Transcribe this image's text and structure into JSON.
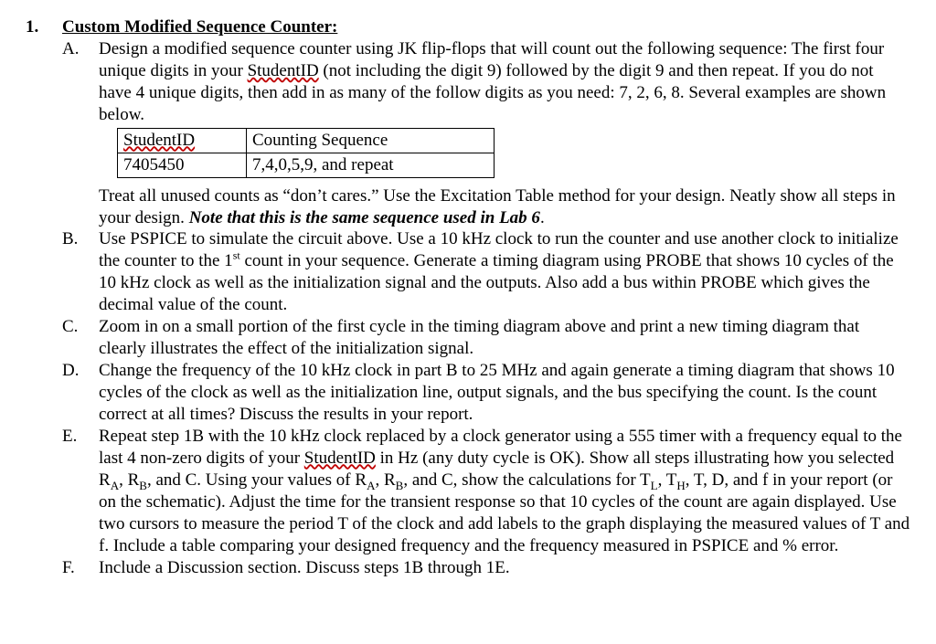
{
  "problem": {
    "number": "1.",
    "title": "Custom Modified Sequence Counter:",
    "items": {
      "A": {
        "letter": "A.",
        "text_pre": "Design a modified sequence counter using JK flip-flops that will count out the following sequence: The first four unique digits in your ",
        "wavy1": "StudentID",
        "text_mid": " (not including the digit 9) followed by the digit 9 and then repeat.  If you do not have 4 unique digits, then add in as many of the follow digits as you need:  7, 2, 6, 8.  Several examples are shown below.",
        "table_header_1": "StudentID",
        "table_header_2": "Counting Sequence",
        "table_row_1": "7405450",
        "table_row_2": "7,4,0,5,9, and repeat",
        "text_after": "Treat all unused counts as “don’t cares.”  Use the Excitation Table method for your design.  Neatly show all steps in your design.  ",
        "note": "Note that this is the same sequence used in Lab 6"
      },
      "B": {
        "letter": "B.",
        "t1": "Use PSPICE to simulate the circuit above.  Use a 10 kHz clock to run the counter and use another clock to initialize the counter to the 1",
        "sup": "st",
        "t2": " count in your sequence.  Generate a timing diagram using PROBE that shows 10 cycles of the 10 kHz clock as well as the initialization signal and the outputs.  Also add a bus within PROBE which gives the decimal value of the count."
      },
      "C": {
        "letter": "C.",
        "text": "Zoom in on a small portion of the first cycle in the timing diagram above and print a new timing diagram that clearly illustrates the effect of the initialization signal."
      },
      "D": {
        "letter": "D.",
        "text": "Change the frequency of the 10 kHz clock in part B to 25 MHz and again generate a timing diagram that shows 10 cycles of the clock as well as the initialization line, output signals, and the bus specifying the count.  Is the count correct at all times?  Discuss the results in your report."
      },
      "E": {
        "letter": "E.",
        "t1": "Repeat step 1B with the 10 kHz clock replaced by a clock generator using a 555 timer with a frequency equal to the last 4 non-zero digits of your ",
        "wavy1": "StudentID",
        "t2": " in Hz (any duty cycle is OK).  Show all steps illustrating how you selected R",
        "sA1": "A",
        "c1": ", R",
        "sB1": "B",
        "c2": ", and C.  Using your values of R",
        "sA2": "A",
        "c3": ", R",
        "sB2": "B",
        "c4": ", and C, show the calculations for T",
        "sL": "L",
        "c5": ", T",
        "sH": "H",
        "t3": ", T, D, and f in your report (or on the schematic).  Adjust the time for the transient response so that 10 cycles of the count are again displayed.  Use two cursors to measure the period T of the clock and add labels to the graph displaying the measured values of T and f.  Include a table comparing your designed frequency and the frequency measured in PSPICE and % error."
      },
      "F": {
        "letter": "F.",
        "text": "Include a Discussion section.  Discuss steps 1B through 1E."
      }
    }
  }
}
